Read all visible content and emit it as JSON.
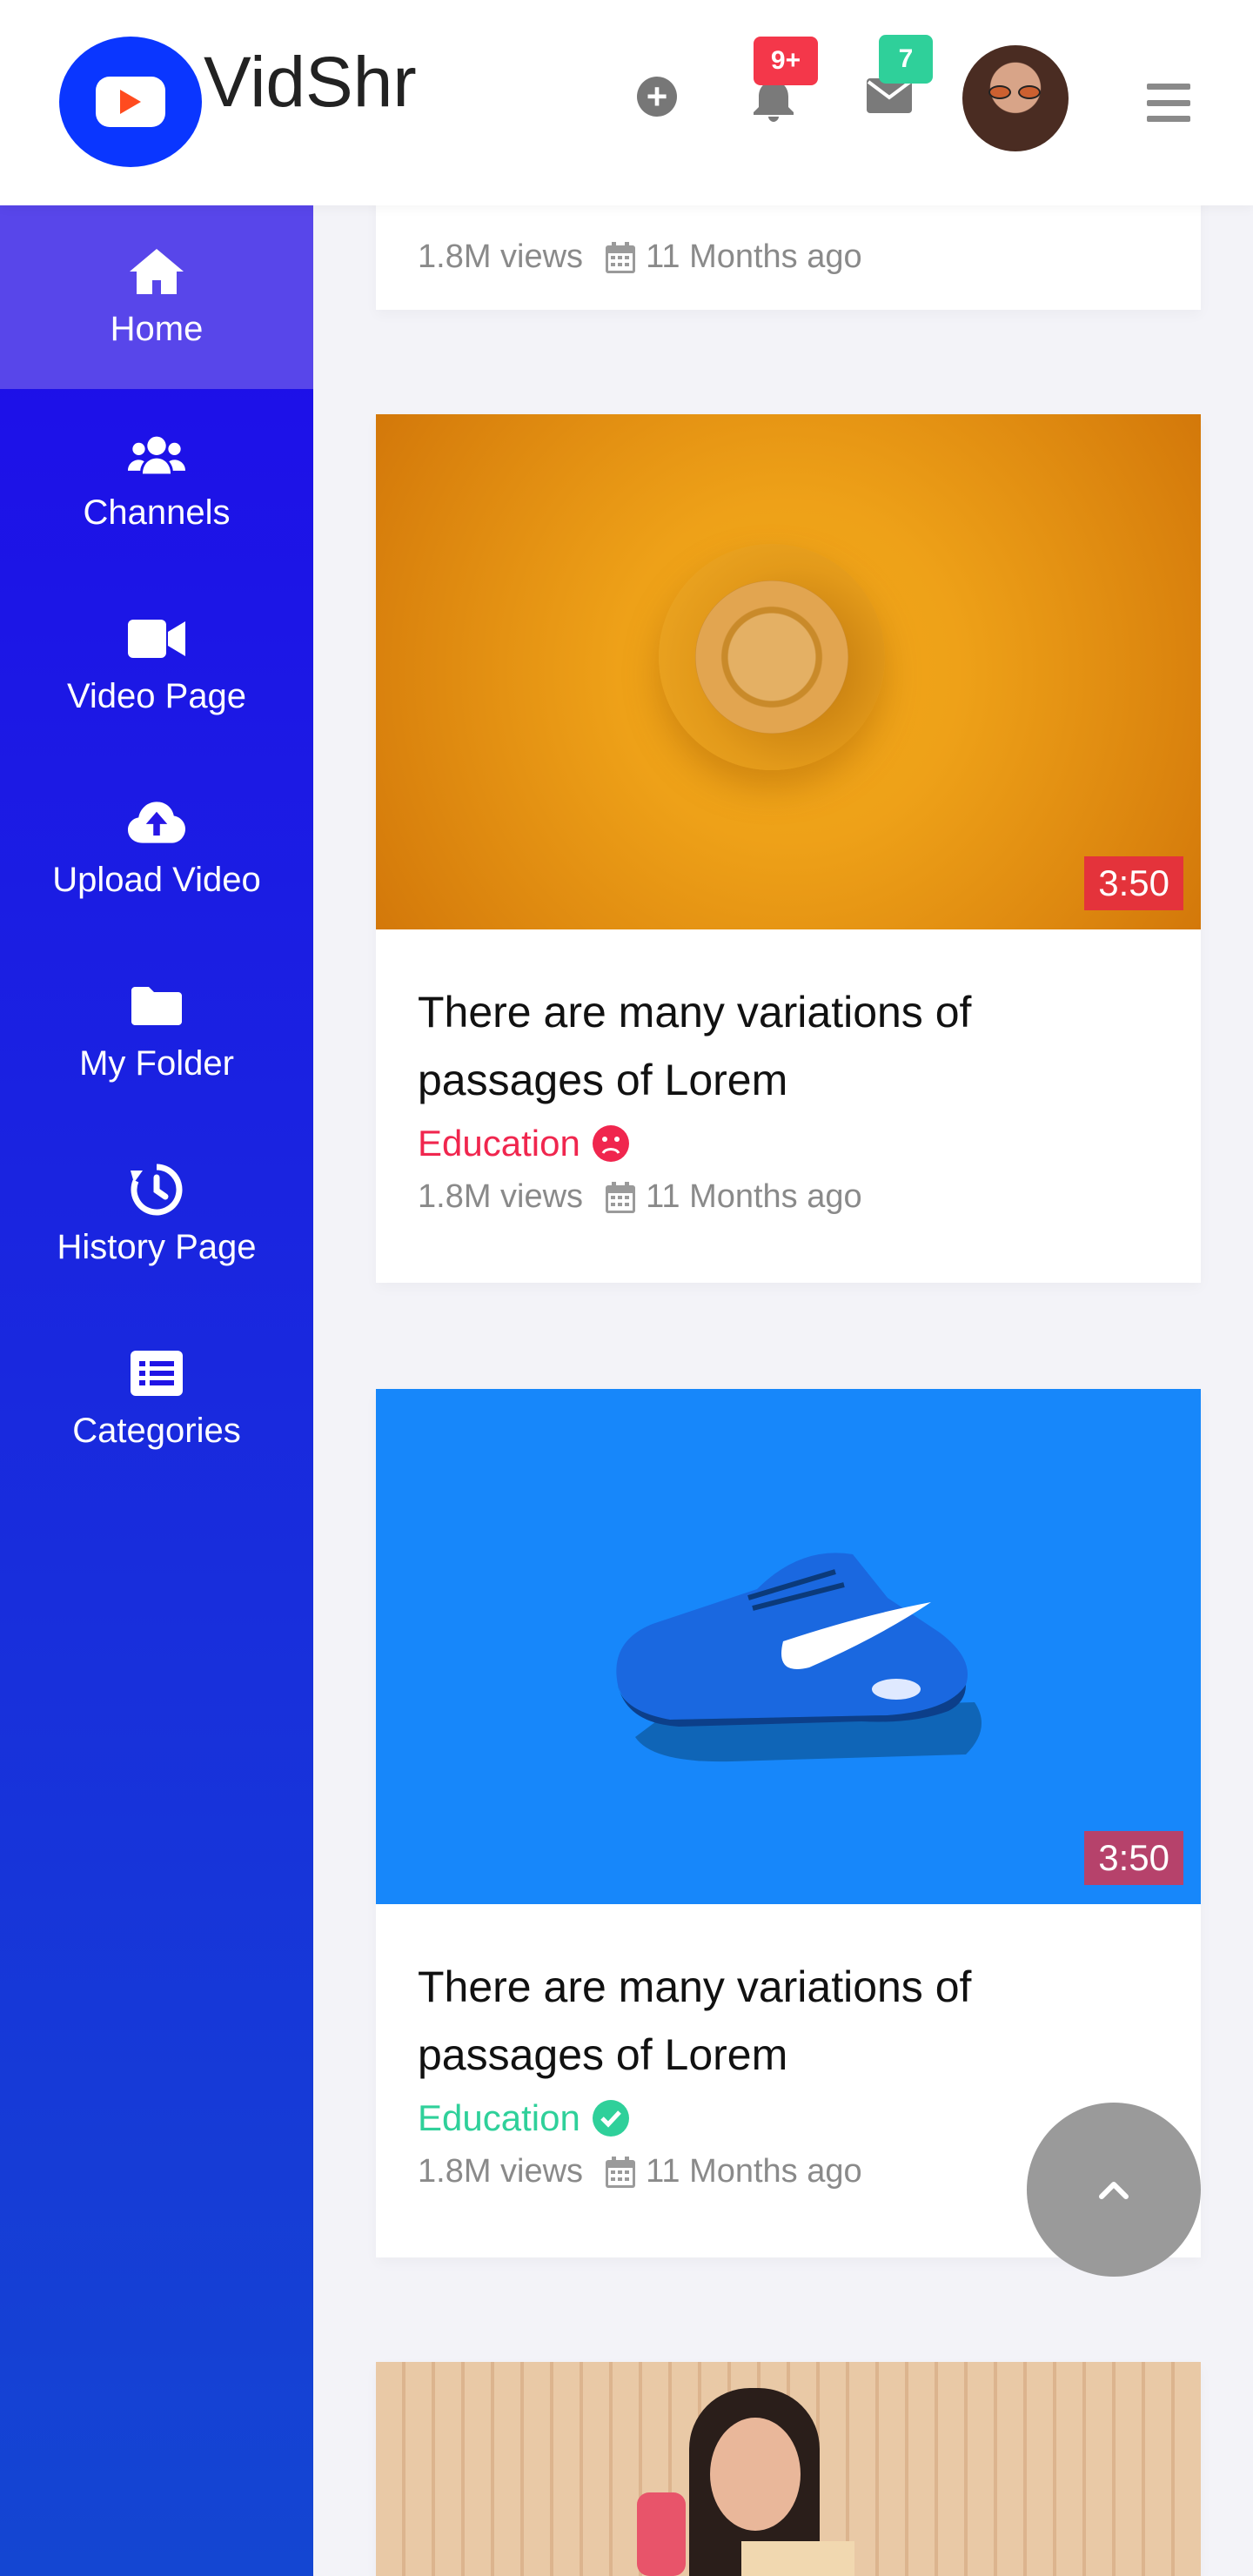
{
  "app": {
    "name": "VidShr"
  },
  "header": {
    "notifications_badge": "9+",
    "messages_badge": "7",
    "colors": {
      "badge_notifications": "#f4374a",
      "badge_messages": "#2fd09a"
    }
  },
  "sidebar": {
    "items": [
      {
        "label": "Home",
        "icon": "home-icon",
        "active": true
      },
      {
        "label": "Channels",
        "icon": "users-icon"
      },
      {
        "label": "Video Page",
        "icon": "video-camera-icon"
      },
      {
        "label": "Upload Video",
        "icon": "cloud-upload-icon"
      },
      {
        "label": "My Folder",
        "icon": "folder-icon"
      },
      {
        "label": "History Page",
        "icon": "history-icon"
      },
      {
        "label": "Categories",
        "icon": "list-icon"
      }
    ]
  },
  "videos": [
    {
      "views": "1.8M views",
      "date": "11 Months ago"
    },
    {
      "duration": "3:50",
      "duration_color": "#e4333b",
      "title": "There are many variations of passages of Lorem",
      "category": "Education",
      "category_color": "#f0264e",
      "status_icon": "sad-face-icon",
      "views": "1.8M views",
      "date": "11 Months ago"
    },
    {
      "duration": "3:50",
      "duration_color": "#b6426b",
      "title": "There are many variations of passages of Lorem",
      "category": "Education",
      "category_color": "#2fd09a",
      "status_icon": "check-circle-icon",
      "views": "1.8M views",
      "date": "11 Months ago"
    }
  ],
  "colors": {
    "sidebar_top": "#1e0cea",
    "sidebar_bottom": "#1446d2",
    "active_item": "#5846ea",
    "brand": "#0a36ff"
  }
}
